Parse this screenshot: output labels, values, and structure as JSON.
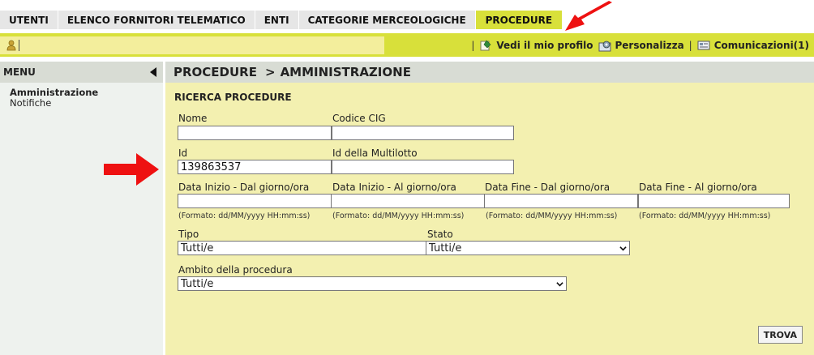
{
  "nav": {
    "tabs": [
      {
        "label": "UTENTI"
      },
      {
        "label": "ELENCO FORNITORI TELEMATICO"
      },
      {
        "label": "ENTI"
      },
      {
        "label": "CATEGORIE MERCEOLOGICHE"
      },
      {
        "label": "PROCEDURE"
      }
    ],
    "active": "PROCEDURE",
    "accent_color": "#d8e03a"
  },
  "userbar": {
    "separator": "|",
    "profile_link": "Vedi il mio profilo",
    "customize_link": "Personalizza",
    "messages_link": "Comunicazioni(1)"
  },
  "sidebar": {
    "header": "MENU",
    "items": [
      {
        "label": "Amministrazione"
      },
      {
        "label": "Notifiche"
      }
    ]
  },
  "breadcrumb": {
    "section": "PROCEDURE",
    "arrow": ">",
    "page": "AMMINISTRAZIONE"
  },
  "form": {
    "title": "RICERCA PROCEDURE",
    "nome": {
      "label": "Nome",
      "value": ""
    },
    "cig": {
      "label": "Codice CIG",
      "value": ""
    },
    "id": {
      "label": "Id",
      "value": "139863537"
    },
    "multilotto": {
      "label": "Id della Multilotto",
      "value": ""
    },
    "dates": [
      {
        "label": "Data Inizio - Dal giorno/ora",
        "value": "",
        "hint": "(Formato: dd/MM/yyyy HH:mm:ss)"
      },
      {
        "label": "Data Inizio - Al giorno/ora",
        "value": "",
        "hint": "(Formato: dd/MM/yyyy HH:mm:ss)"
      },
      {
        "label": "Data Fine - Dal giorno/ora",
        "value": "",
        "hint": "(Formato: dd/MM/yyyy HH:mm:ss)"
      },
      {
        "label": "Data Fine - Al giorno/ora",
        "value": "",
        "hint": "(Formato: dd/MM/yyyy HH:mm:ss)"
      }
    ],
    "tipo": {
      "label": "Tipo",
      "value": "Tutti/e"
    },
    "stato": {
      "label": "Stato",
      "value": "Tutti/e"
    },
    "ambito": {
      "label": "Ambito della procedura",
      "value": "Tutti/e"
    },
    "submit": "TROVA"
  },
  "annotations": {
    "arrow_color": "#ee1111"
  }
}
